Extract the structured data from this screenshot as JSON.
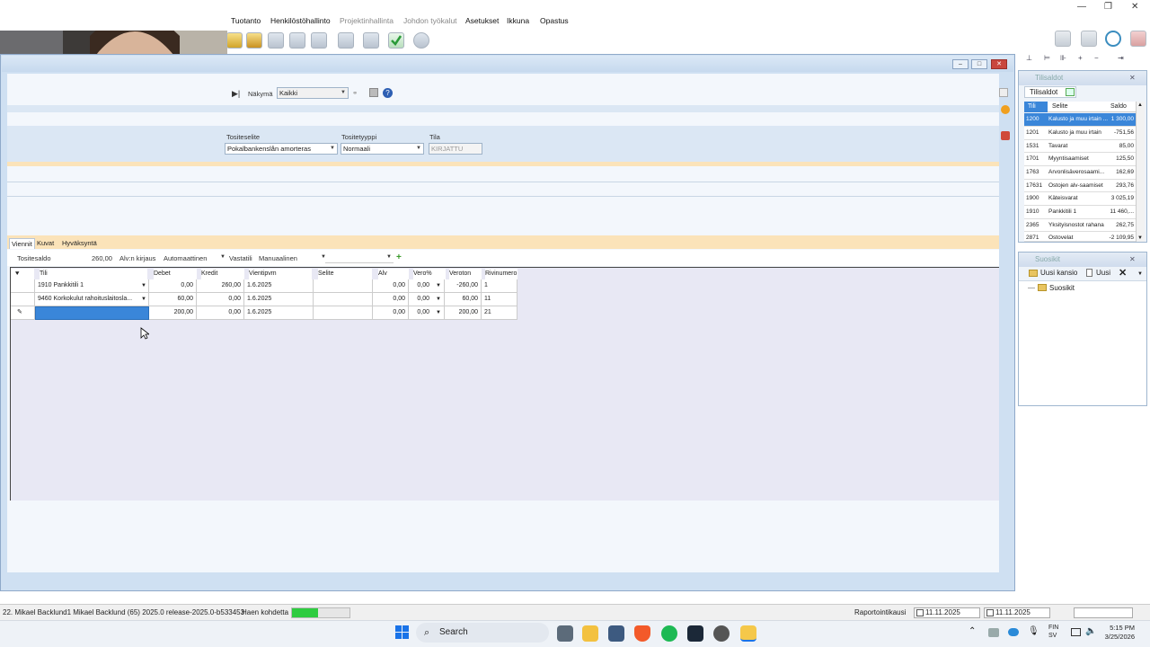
{
  "menu": {
    "items": [
      "Tuotanto",
      "Henkilöstöhallinto",
      "Projektinhallinta",
      "Johdon työkalut",
      "Asetukset",
      "Ikkuna",
      "Opastus"
    ],
    "dimmed": [
      false,
      false,
      true,
      true,
      false,
      false,
      false
    ]
  },
  "window_controls": {
    "minimize": "—",
    "restore": "❐",
    "close": "✕"
  },
  "form": {
    "nakyma_label": "Näkymä",
    "nakyma_value": "Kaikki",
    "tositeselite_label": "Tositeselite",
    "tositeselite_value": "Pokalbankenslån amorteras",
    "tositetyyppi_label": "Tositetyyppi",
    "tositetyyppi_value": "Normaali",
    "tila_label": "Tila",
    "tila_value": "KIRJATTU"
  },
  "tabs": [
    "Viennit",
    "Kuvat",
    "Hyväksyntä"
  ],
  "entry_toolbar": {
    "tositesaldo_label": "Tositesaldo",
    "tositesaldo_value": "260,00",
    "alv_label": "Alv:n kirjaus",
    "alv_value": "Automaattinen",
    "vastatili_label": "Vastatili",
    "vastatili_value": "Manuaalinen"
  },
  "grid": {
    "columns": [
      "Tili",
      "Debet",
      "Kredit",
      "Vientipvm",
      "Selite",
      "Alv",
      "Vero%",
      "Veroton",
      "Rivinumero"
    ],
    "rows": [
      {
        "tili": "1910 Pankkitili 1",
        "debet": "0,00",
        "kredit": "260,00",
        "pvm": "1.6.2025",
        "selite": "",
        "alv": "0,00",
        "vero": "0,00",
        "veroton": "-260,00",
        "rivi": "1"
      },
      {
        "tili": "9460 Korkokulut rahoituslaitosla...",
        "debet": "60,00",
        "kredit": "0,00",
        "pvm": "1.6.2025",
        "selite": "",
        "alv": "0,00",
        "vero": "0,00",
        "veroton": "60,00",
        "rivi": "11"
      },
      {
        "tili": "",
        "debet": "200,00",
        "kredit": "0,00",
        "pvm": "1.6.2025",
        "selite": "",
        "alv": "0,00",
        "vero": "0,00",
        "veroton": "200,00",
        "rivi": "21"
      }
    ]
  },
  "tilisaldot": {
    "title": "Tilisaldot",
    "tab": "Tilisaldot",
    "columns": [
      "Tili",
      "Selite",
      "Saldo"
    ],
    "rows": [
      {
        "tili": "1200",
        "selite": "Kalusto ja muu irtain ...",
        "saldo": "1 300,00"
      },
      {
        "tili": "1201",
        "selite": "Kalusto ja muu irtain",
        "saldo": "-751,56"
      },
      {
        "tili": "1531",
        "selite": "Tavarat",
        "saldo": "85,00"
      },
      {
        "tili": "1701",
        "selite": "Myyntisaamiset",
        "saldo": "125,50"
      },
      {
        "tili": "1763",
        "selite": "Arvonlisäverosaami...",
        "saldo": "162,69"
      },
      {
        "tili": "17631",
        "selite": "Ostojen alv-saamiset",
        "saldo": "293,76"
      },
      {
        "tili": "1900",
        "selite": "Käteisvarat",
        "saldo": "3 025,19"
      },
      {
        "tili": "1910",
        "selite": "Pankkitili 1",
        "saldo": "11 460,..."
      },
      {
        "tili": "2365",
        "selite": "Yksityisnostot rahana",
        "saldo": "262,75"
      },
      {
        "tili": "2871",
        "selite": "Ostovelat",
        "saldo": "-2 109,95"
      }
    ]
  },
  "suosikit": {
    "title": "Suosikit",
    "new_folder": "Uusi kansio",
    "new": "Uusi",
    "root": "Suosikit"
  },
  "status": {
    "user": "22. Mikael Backlund1   Mikael Backlund (65)   2025.0 release-2025.0-b533453",
    "search": "Haen kohdetta",
    "progress": 0.45,
    "report_label": "Raportointikausi",
    "date_from": "11.11.2025",
    "date_to": "11.11.2025"
  },
  "taskbar": {
    "search": "Search",
    "lang1": "FIN",
    "lang2": "SV",
    "time": "5:15 PM",
    "date": "3/25/2026"
  },
  "colors": {
    "accent": "#3a86d9",
    "orange_band": "#fbe3b9",
    "progress": "#2ecc40"
  }
}
